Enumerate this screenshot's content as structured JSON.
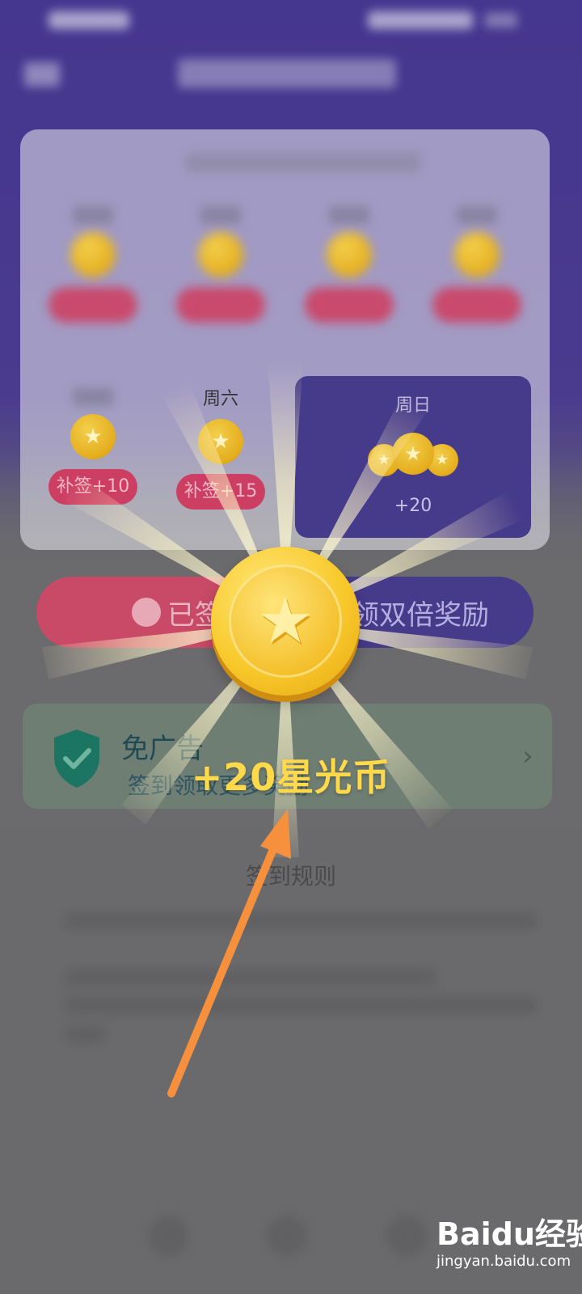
{
  "page": {
    "title": ""
  },
  "checkin": {
    "days": [
      {
        "label": "",
        "reward": ""
      },
      {
        "label": "",
        "reward": ""
      },
      {
        "label": "",
        "reward": ""
      },
      {
        "label": "",
        "reward": ""
      },
      {
        "label": "",
        "reward": "补签+10"
      },
      {
        "label": "周六",
        "reward": "补签+15"
      },
      {
        "label": "周日",
        "reward": "+20"
      }
    ],
    "star_glyph": "★"
  },
  "actions": {
    "signed_label": "已签到",
    "double_label": "领双倍奖励"
  },
  "ad_free_banner": {
    "title": "免广告",
    "subtitle": "签到领取更多奖励",
    "arrow": "›"
  },
  "rules": {
    "title": "签到规则"
  },
  "reward_popup": {
    "text": "+20星光币",
    "coin_icon": "star-coin-icon"
  },
  "watermark": {
    "brand": "Baidu经验",
    "url": "jingyan.baidu.com"
  },
  "colors": {
    "purple": "#463a8a",
    "pink": "#cc3e62",
    "gold": "#ffd94a",
    "arrow": "#f6903c"
  }
}
